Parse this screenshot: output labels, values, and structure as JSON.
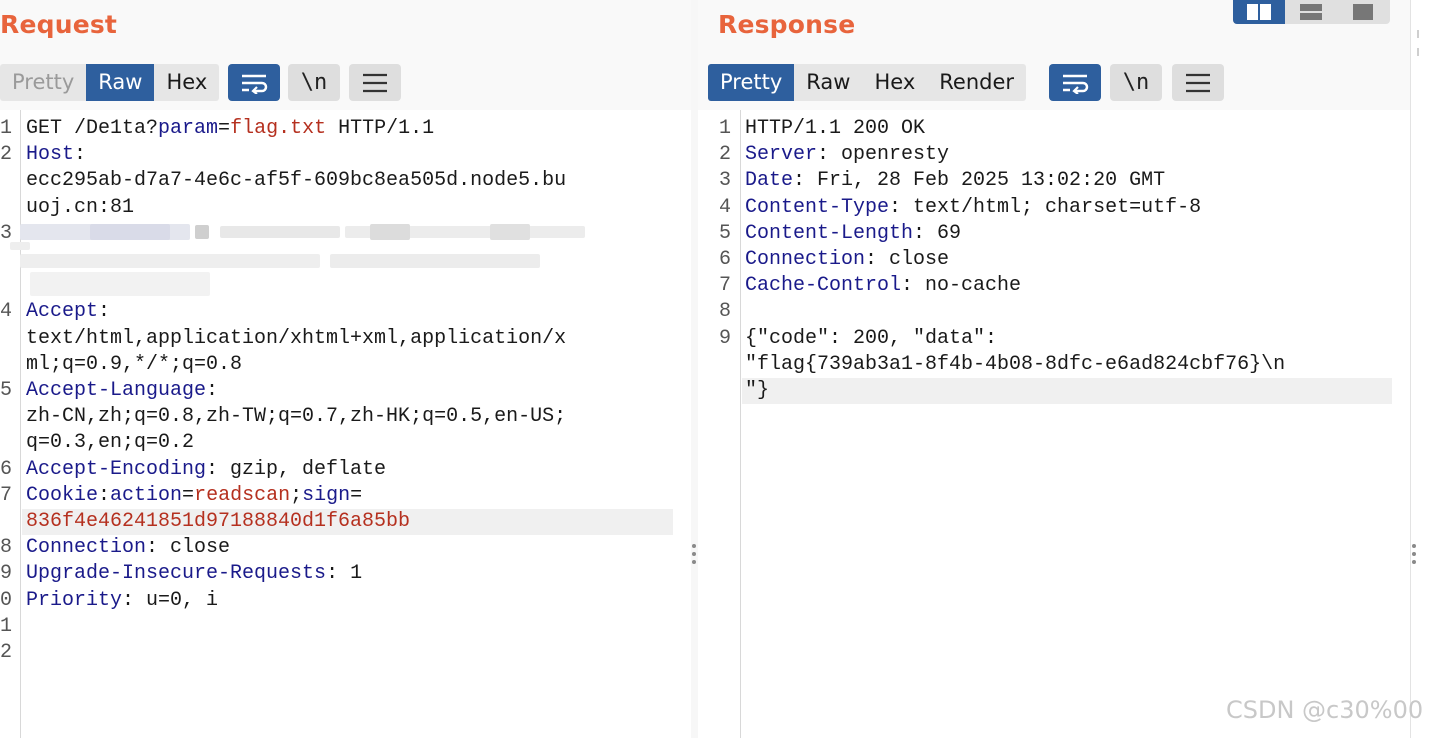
{
  "request": {
    "title": "Request",
    "tabs": [
      "Pretty",
      "Raw",
      "Hex"
    ],
    "newline_label": "\\n",
    "lines": [
      {
        "n": "1",
        "segs": [
          [
            "t",
            "GET /De1ta?"
          ],
          [
            "k",
            "param"
          ],
          [
            "t",
            "="
          ],
          [
            "v",
            "flag.txt"
          ],
          [
            "t",
            " HTTP/1.1"
          ]
        ]
      },
      {
        "n": "2",
        "segs": [
          [
            "k",
            "Host"
          ],
          [
            "t",
            ":"
          ]
        ]
      },
      {
        "n": "",
        "segs": [
          [
            "t",
            "ecc295ab-d7a7-4e6c-af5f-609bc8ea505d.node5.bu"
          ]
        ]
      },
      {
        "n": "",
        "segs": [
          [
            "t",
            "uoj.cn:81"
          ]
        ]
      },
      {
        "n": "3",
        "segs": []
      },
      {
        "n": "",
        "segs": []
      },
      {
        "n": "",
        "segs": []
      },
      {
        "n": "4",
        "segs": [
          [
            "k",
            "Accept"
          ],
          [
            "t",
            ":"
          ]
        ]
      },
      {
        "n": "",
        "segs": [
          [
            "t",
            "text/html,application/xhtml+xml,application/x"
          ]
        ]
      },
      {
        "n": "",
        "segs": [
          [
            "t",
            "ml;q=0.9,*/*;q=0.8"
          ]
        ]
      },
      {
        "n": "5",
        "segs": [
          [
            "k",
            "Accept-Language"
          ],
          [
            "t",
            ":"
          ]
        ]
      },
      {
        "n": "",
        "segs": [
          [
            "t",
            "zh-CN,zh;q=0.8,zh-TW;q=0.7,zh-HK;q=0.5,en-US;"
          ]
        ]
      },
      {
        "n": "",
        "segs": [
          [
            "t",
            "q=0.3,en;q=0.2"
          ]
        ]
      },
      {
        "n": "6",
        "segs": [
          [
            "k",
            "Accept-Encoding"
          ],
          [
            "t",
            ": gzip, deflate"
          ]
        ]
      },
      {
        "n": "7",
        "segs": [
          [
            "k",
            "Cookie"
          ],
          [
            "t",
            ":"
          ],
          [
            "k",
            "action"
          ],
          [
            "t",
            "="
          ],
          [
            "v",
            "readscan"
          ],
          [
            "t",
            ";"
          ],
          [
            "k",
            "sign"
          ],
          [
            "t",
            "="
          ]
        ]
      },
      {
        "n": "",
        "segs": [
          [
            "v",
            "836f4e46241851d97188840d1f6a85bb"
          ]
        ],
        "hl": true
      },
      {
        "n": "8",
        "segs": [
          [
            "k",
            "Connection"
          ],
          [
            "t",
            ": close"
          ]
        ]
      },
      {
        "n": "9",
        "segs": [
          [
            "k",
            "Upgrade-Insecure-Requests"
          ],
          [
            "t",
            ": 1"
          ]
        ]
      },
      {
        "n": "0",
        "segs": [
          [
            "k",
            "Priority"
          ],
          [
            "t",
            ": u=0, i"
          ]
        ]
      },
      {
        "n": "1",
        "segs": []
      },
      {
        "n": "2",
        "segs": []
      }
    ]
  },
  "response": {
    "title": "Response",
    "tabs": [
      "Pretty",
      "Raw",
      "Hex",
      "Render"
    ],
    "newline_label": "\\n",
    "lines": [
      {
        "n": "1",
        "segs": [
          [
            "t",
            "HTTP/1.1 200 OK"
          ]
        ]
      },
      {
        "n": "2",
        "segs": [
          [
            "k",
            "Server"
          ],
          [
            "t",
            ": openresty"
          ]
        ]
      },
      {
        "n": "3",
        "segs": [
          [
            "k",
            "Date"
          ],
          [
            "t",
            ": Fri, 28 Feb 2025 13:02:20 GMT"
          ]
        ]
      },
      {
        "n": "4",
        "segs": [
          [
            "k",
            "Content-Type"
          ],
          [
            "t",
            ": text/html; charset=utf-8"
          ]
        ]
      },
      {
        "n": "5",
        "segs": [
          [
            "k",
            "Content-Length"
          ],
          [
            "t",
            ": 69"
          ]
        ]
      },
      {
        "n": "6",
        "segs": [
          [
            "k",
            "Connection"
          ],
          [
            "t",
            ": close"
          ]
        ]
      },
      {
        "n": "7",
        "segs": [
          [
            "k",
            "Cache-Control"
          ],
          [
            "t",
            ": no-cache"
          ]
        ]
      },
      {
        "n": "8",
        "segs": []
      },
      {
        "n": "9",
        "segs": [
          [
            "t",
            "{\"code\": 200, \"data\":"
          ]
        ]
      },
      {
        "n": "",
        "segs": [
          [
            "t",
            "\"flag{739ab3a1-8f4b-4b08-8dfc-e6ad824cbf76}\\n"
          ]
        ]
      },
      {
        "n": "",
        "segs": [
          [
            "t",
            "\"}"
          ]
        ],
        "hl": true
      }
    ]
  },
  "watermark": "CSDN @c30%00",
  "colors": {
    "accent_title": "#e8643c",
    "active_tab": "#2e5f9e",
    "header_key": "#1a1a8a",
    "value_red": "#b5301f"
  }
}
